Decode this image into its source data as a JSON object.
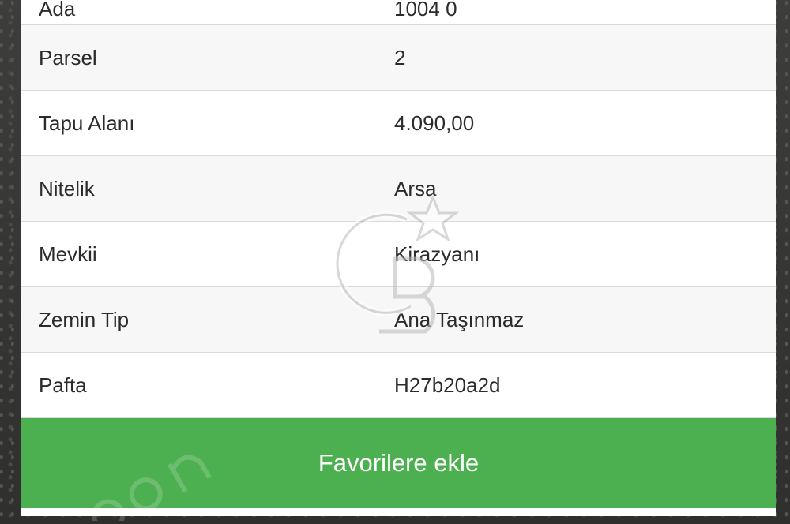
{
  "rows": [
    {
      "label": "Ada",
      "value": "1004 0"
    },
    {
      "label": "Parsel",
      "value": "2"
    },
    {
      "label": "Tapu Alanı",
      "value": "4.090,00"
    },
    {
      "label": "Nitelik",
      "value": "Arsa"
    },
    {
      "label": "Mevkii",
      "value": "Kirazyanı"
    },
    {
      "label": "Zemin Tip",
      "value": "Ana Taşınmaz"
    },
    {
      "label": "Pafta",
      "value": "H27b20a2d"
    }
  ],
  "actions": {
    "favorite_label": "Favorilere ekle"
  },
  "colors": {
    "action_green": "#4caf50",
    "row_alt": "#f7f7f7",
    "border": "#d9d9d9"
  },
  "icons": {
    "watermark": "cb-star-logo-icon"
  }
}
